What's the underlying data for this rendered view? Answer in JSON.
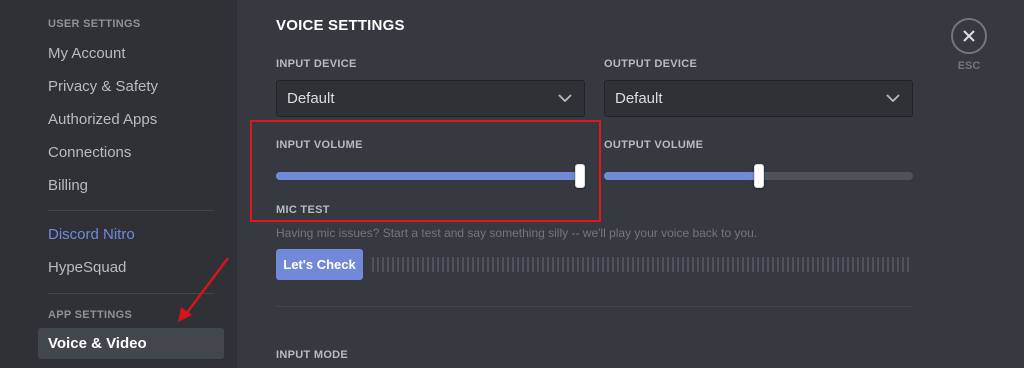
{
  "sidebar": {
    "user_settings_header": "USER SETTINGS",
    "items": [
      {
        "label": "My Account"
      },
      {
        "label": "Privacy & Safety"
      },
      {
        "label": "Authorized Apps"
      },
      {
        "label": "Connections"
      },
      {
        "label": "Billing"
      }
    ],
    "nitro": {
      "label": "Discord Nitro"
    },
    "hypesquad": {
      "label": "HypeSquad"
    },
    "app_settings_header": "APP SETTINGS",
    "voice_video": {
      "label": "Voice & Video",
      "selected": true
    }
  },
  "main": {
    "title": "VOICE SETTINGS",
    "input_device": {
      "label": "INPUT DEVICE",
      "value": "Default"
    },
    "output_device": {
      "label": "OUTPUT DEVICE",
      "value": "Default"
    },
    "input_volume": {
      "label": "INPUT VOLUME",
      "level": 1.0
    },
    "output_volume": {
      "label": "OUTPUT VOLUME",
      "level": 0.5
    },
    "mic_test": {
      "label": "MIC TEST",
      "description": "Having mic issues? Start a test and say something silly -- we'll play your voice back to you.",
      "button": "Let's Check"
    },
    "input_mode": {
      "label": "INPUT MODE"
    }
  },
  "close": {
    "label": "ESC"
  },
  "colors": {
    "accent": "#7289da",
    "highlight": "#e2161d",
    "background": "#36393f",
    "sidebar": "#2f3136"
  },
  "icons": {
    "close": "close-icon",
    "dropdown": "chevron-down-icon",
    "annotation": "red-arrow"
  }
}
